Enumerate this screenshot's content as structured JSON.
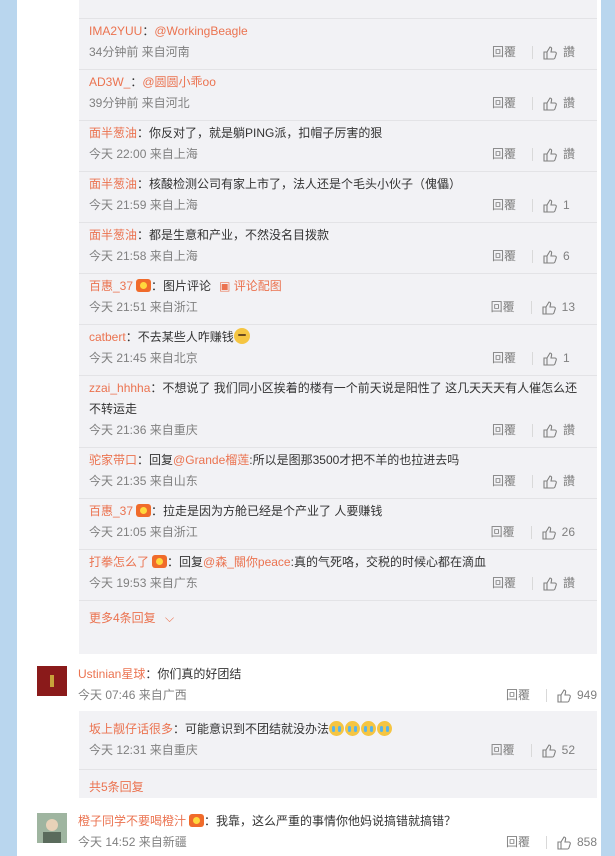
{
  "thread_replies": [
    {
      "name": "IMA2YUU",
      "sep": "：",
      "text": "",
      "at": "@WorkingBeagle",
      "time": "34分钟前 来自河南",
      "reply_label": "回覆",
      "likes": "讚",
      "badge": false
    },
    {
      "name": "AD3W_",
      "sep": "：",
      "text": "",
      "at": "@圆圆小乖oo",
      "time": "39分钟前 来自河北",
      "reply_label": "回覆",
      "likes": "讚",
      "badge": false
    },
    {
      "name": "面半葱油",
      "sep": "：",
      "text": "你反对了，就是躺PING派，扣帽子厉害的狠",
      "at": "",
      "time": "今天 22:00 来自上海",
      "reply_label": "回覆",
      "likes": "讚",
      "badge": false
    },
    {
      "name": "面半葱油",
      "sep": "：",
      "text": "核酸检测公司有家上市了，法人还是个毛头小伙子（傀儡）",
      "at": "",
      "time": "今天 21:59 来自上海",
      "reply_label": "回覆",
      "likes": "1",
      "badge": false
    },
    {
      "name": "面半葱油",
      "sep": "：",
      "text": "都是生意和产业，不然没名目拨款",
      "at": "",
      "time": "今天 21:58 来自上海",
      "reply_label": "回覆",
      "likes": "6",
      "badge": false
    },
    {
      "name": "百惠_37",
      "sep": "：",
      "text": "图片评论",
      "at": "",
      "time": "今天 21:51 来自浙江",
      "reply_label": "回覆",
      "likes": "13",
      "badge": true,
      "img_link": "评论配图"
    },
    {
      "name": "catbert",
      "sep": "：",
      "text": "不去某些人咋赚钱",
      "at": "",
      "time": "今天 21:45 来自北京",
      "reply_label": "回覆",
      "likes": "1",
      "badge": false,
      "emoji": true
    },
    {
      "name": "zzai_hhhha",
      "sep": "：",
      "text": "不想说了 我们同小区挨着的楼有一个前天说是阳性了 这几天天天有人催怎么还不转运走",
      "at": "",
      "time": "今天 21:36 来自重庆",
      "reply_label": "回覆",
      "likes": "讚",
      "badge": false
    },
    {
      "name": "驼家带口",
      "sep": "：",
      "text": "回复",
      "at": "@Grande榴莲",
      "text2": ":所以是图那3500才把不羊的也拉进去吗",
      "time": "今天 21:35 来自山东",
      "reply_label": "回覆",
      "likes": "讚",
      "badge": false
    },
    {
      "name": "百惠_37",
      "sep": "：",
      "text": "拉走是因为方舱已经是个产业了 人要赚钱",
      "at": "",
      "time": "今天 21:05 来自浙江",
      "reply_label": "回覆",
      "likes": "26",
      "badge": true
    },
    {
      "name": "打拳怎么了",
      "sep": "：",
      "text": "回复",
      "at": "@森_關你peace",
      "text2": ":真的气死咯，交税的时候心都在滴血",
      "time": "今天 19:53 来自广东",
      "reply_label": "回覆",
      "likes": "讚",
      "badge": true
    }
  ],
  "more_replies_1": "更多4条回复",
  "top_comment_1": {
    "name": "Ustinian星球",
    "sep": "：",
    "text": "你们真的好团结",
    "time": "今天 07:46 来自广西",
    "reply_label": "回覆",
    "likes": "949"
  },
  "sub_reply_1": {
    "name": "坂上靓仔话很多",
    "sep": "：",
    "text": "可能意识到不团结就没办法",
    "time": "今天 12:31 来自重庆",
    "reply_label": "回覆",
    "likes": "52"
  },
  "total_replies_1": "共5条回复",
  "top_comment_2": {
    "name": "橙子同学不要喝橙汁",
    "sep": "：",
    "text": "我靠，这么严重的事情你他妈说搞错就搞错？",
    "time": "今天 14:52 来自新疆",
    "reply_label": "回覆",
    "likes": "858"
  },
  "colors": {
    "link": "#eb7350",
    "meta": "#808080",
    "reply_bg": "#f2f2f5",
    "rail": "#b9d6ee"
  }
}
